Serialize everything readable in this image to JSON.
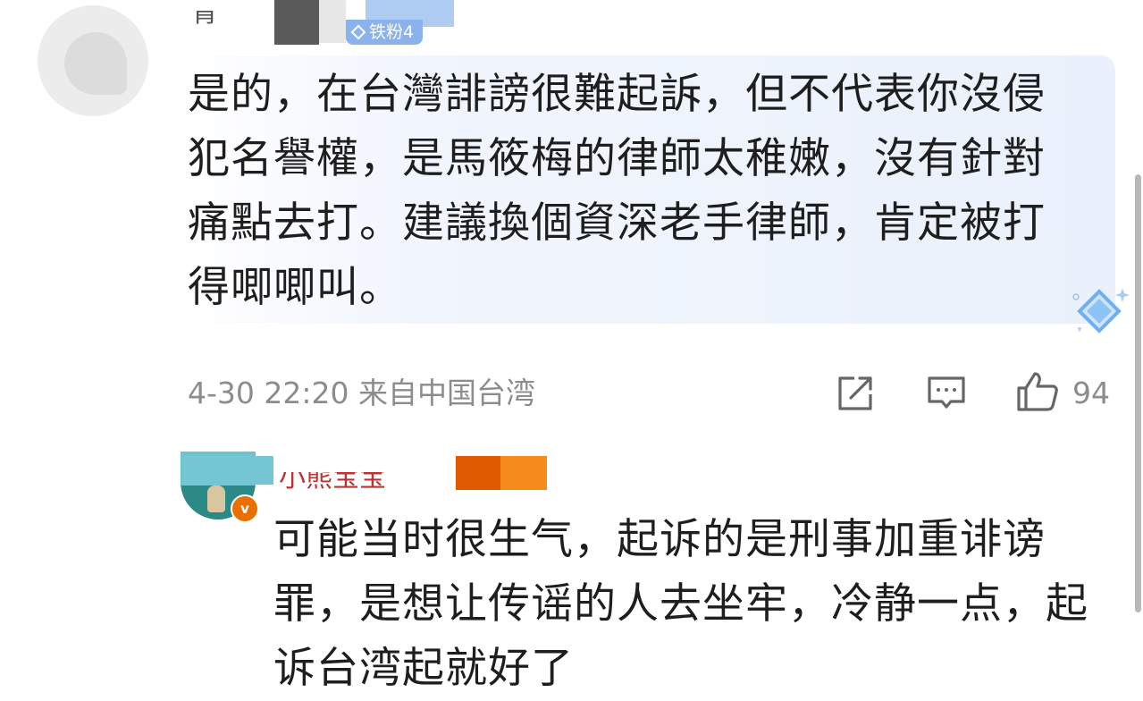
{
  "comments": [
    {
      "username": "青",
      "fan_badge": "铁粉4",
      "text": "是的，在台灣誹謗很難起訴，但不代表你沒侵犯名譽權，是馬筱梅的律師太稚嫩，沒有針對痛點去打。建議換個資深老手律師，肯定被打得唧唧叫。",
      "timestamp": "4-30 22:20",
      "location": "来自中国台湾",
      "likes": "94"
    },
    {
      "username": "小熊宝宝",
      "verified_badge": "v",
      "text": "可能当时很生气，起诉的是刑事加重诽谤罪，是想让传谣的人去坐牢，冷静一点，起诉台湾起就好了"
    }
  ],
  "icons": {
    "share": "share-icon",
    "comment": "comment-icon",
    "like": "thumbs-up-icon"
  },
  "colors": {
    "meta_gray": "#8c8c8c",
    "bubble_blue": "#eaf1fc",
    "fan_badge": "#8ab2ec",
    "vip_orange": "#e86f00"
  }
}
